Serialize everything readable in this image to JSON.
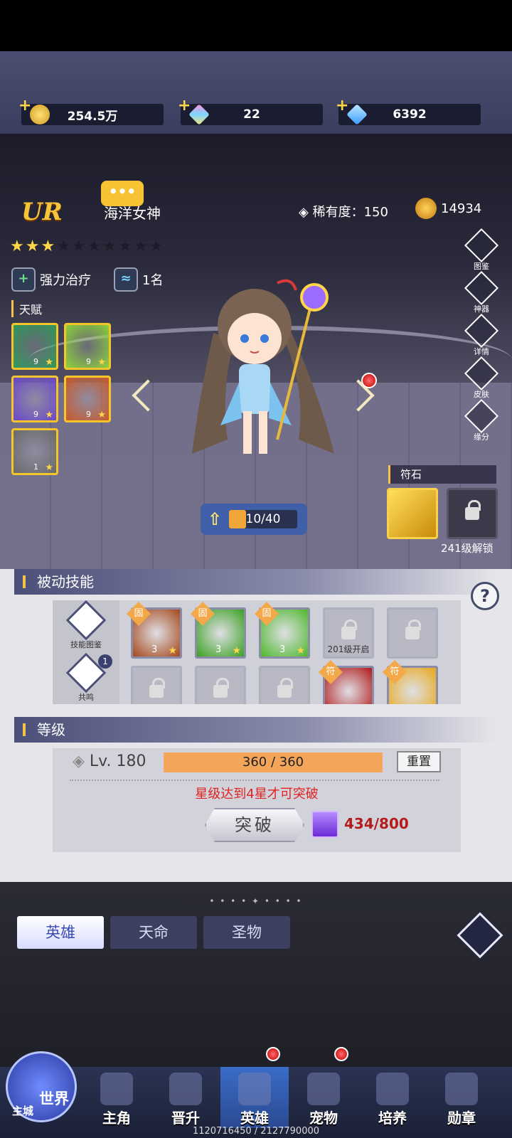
{
  "currency": {
    "gold": "254.5万",
    "crystal": "22",
    "diamond": "6392"
  },
  "hero": {
    "rank": "UR",
    "chat": "•••",
    "name": "海洋女神",
    "rarity_label": "稀有度：150",
    "power": "14934",
    "stars_total": 10,
    "stars_filled": 3,
    "role": "强力治疗",
    "rank_badge": "1名",
    "talent_title": "天赋",
    "talents": [
      {
        "level": "9",
        "color": "#2f9a5a"
      },
      {
        "level": "9",
        "color": "#8cd23a"
      },
      {
        "level": "9",
        "color": "#6b47c9"
      },
      {
        "level": "9",
        "color": "#c85a2a"
      },
      {
        "level": "1",
        "color": "#6a6a6a"
      }
    ],
    "level_progress": "10/40",
    "level_fill": 0.25
  },
  "side_menu": [
    "图鉴",
    "神器",
    "详情",
    "皮肤",
    "缘分"
  ],
  "rune": {
    "title": "符石",
    "unlock_text": "241级解锁"
  },
  "passive": {
    "title": "被动技能",
    "help": "?",
    "side_buttons": [
      "技能图鉴",
      "共鸣"
    ],
    "side_badge": "1",
    "row1": [
      {
        "tag": "固",
        "level": "3",
        "color": "#a4471a"
      },
      {
        "tag": "固",
        "level": "3",
        "color": "#3aa020"
      },
      {
        "tag": "固",
        "level": "3",
        "color": "#4db82a"
      },
      {
        "locked": true,
        "caption": "201级开启"
      },
      {
        "locked": true,
        "caption": ""
      }
    ],
    "row2": [
      {
        "locked": true
      },
      {
        "locked": true
      },
      {
        "locked": true
      },
      {
        "tag": "符",
        "color": "#b01818"
      },
      {
        "tag": "符",
        "color": "#e8a818"
      }
    ]
  },
  "level": {
    "title": "等级",
    "lv_text": "Lv. 180",
    "exp_text": "360 / 360",
    "reset": "重置",
    "warning": "星级达到4星才可突破",
    "breakthrough": "突破",
    "orb_count": "434/800"
  },
  "tabs": {
    "deco": "• • • • ✦ • • • •",
    "items": [
      "英雄",
      "天命",
      "圣物"
    ],
    "active": 0
  },
  "nav": {
    "world": "世界",
    "city": "主城",
    "items": [
      "主角",
      "晋升",
      "英雄",
      "宠物",
      "培养",
      "勋章"
    ],
    "active": 2
  },
  "footer": "1120716450 / 2127790000"
}
